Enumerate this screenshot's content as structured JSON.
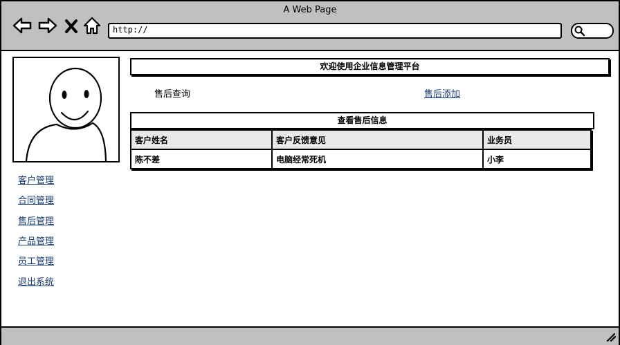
{
  "window": {
    "title": "A Web Page"
  },
  "browser": {
    "url": "http://"
  },
  "sidebar": {
    "items": [
      {
        "label": "客户管理"
      },
      {
        "label": "合同管理"
      },
      {
        "label": "售后管理"
      },
      {
        "label": "产品管理"
      },
      {
        "label": "员工管理"
      },
      {
        "label": "退出系统"
      }
    ]
  },
  "main": {
    "welcome": "欢迎使用企业信息管理平台",
    "query_label": "售后查询",
    "add_link": "售后添加",
    "section_title": "查看售后信息",
    "table": {
      "headers": [
        "客户姓名",
        "客户反馈意见",
        "业务员"
      ],
      "rows": [
        [
          "陈不差",
          "电脑经常死机",
          "小李"
        ]
      ]
    }
  }
}
